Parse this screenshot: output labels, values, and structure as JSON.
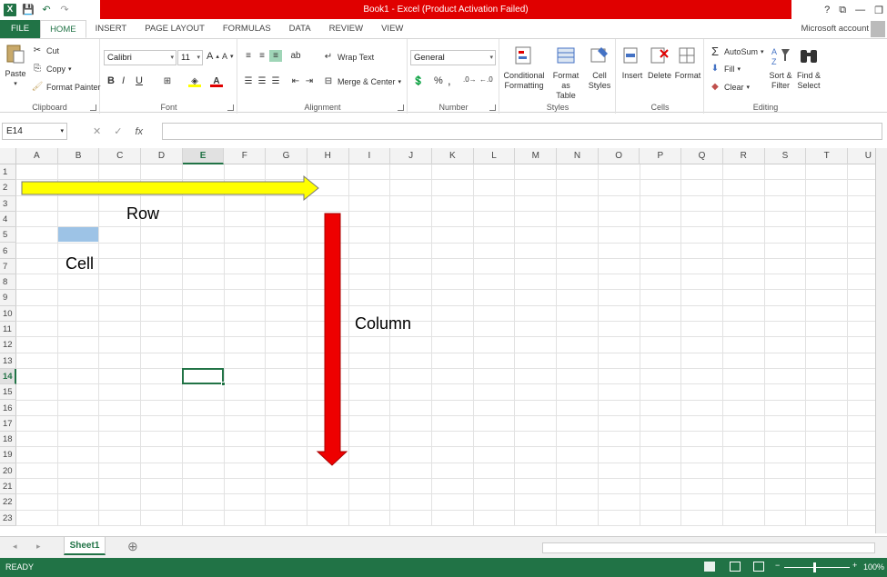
{
  "window": {
    "title": "Book1 -  Excel (Product Activation Failed)",
    "account": "Microsoft account",
    "controls": [
      "?",
      "⧉",
      "—",
      "❐"
    ]
  },
  "qat": {
    "save": "💾",
    "undo": "↶",
    "redo": "↷"
  },
  "tabs": {
    "file": "FILE",
    "items": [
      "HOME",
      "INSERT",
      "PAGE LAYOUT",
      "FORMULAS",
      "DATA",
      "REVIEW",
      "VIEW"
    ],
    "active": "HOME"
  },
  "ribbon": {
    "clipboard": {
      "label": "Clipboard",
      "paste": "Paste",
      "cut": "Cut",
      "copy": "Copy",
      "painter": "Format Painter"
    },
    "font": {
      "label": "Font",
      "name": "Calibri",
      "size": "11",
      "bold": "B",
      "italic": "I",
      "underline": "U",
      "grow": "A",
      "shrink": "A"
    },
    "alignment": {
      "label": "Alignment",
      "wrap": "Wrap Text",
      "merge": "Merge & Center"
    },
    "number": {
      "label": "Number",
      "format": "General",
      "percent": "%",
      "comma": ","
    },
    "styles": {
      "label": "Styles",
      "conditional": [
        "Conditional",
        "Formatting"
      ],
      "table": [
        "Format as",
        "Table"
      ],
      "cell": [
        "Cell",
        "Styles"
      ]
    },
    "cells": {
      "label": "Cells",
      "insert": "Insert",
      "delete": "Delete",
      "format": "Format"
    },
    "editing": {
      "label": "Editing",
      "autosum": "AutoSum",
      "fill": "Fill",
      "clear": "Clear",
      "sort": [
        "Sort &",
        "Filter"
      ],
      "find": [
        "Find &",
        "Select"
      ]
    }
  },
  "formula_bar": {
    "name_box": "E14",
    "fx": "fx",
    "cancel": "✕",
    "enter": "✓",
    "value": ""
  },
  "grid": {
    "columns": [
      "A",
      "B",
      "C",
      "D",
      "E",
      "F",
      "G",
      "H",
      "I",
      "J",
      "K",
      "L",
      "M",
      "N",
      "O",
      "P",
      "Q",
      "R",
      "S",
      "T",
      "U"
    ],
    "rows": [
      "1",
      "2",
      "3",
      "4",
      "5",
      "6",
      "7",
      "8",
      "9",
      "10",
      "11",
      "12",
      "13",
      "14",
      "15",
      "16",
      "17",
      "18",
      "19",
      "20",
      "21",
      "22",
      "23"
    ],
    "selected_cell": "E14",
    "highlighted_cell": "B5"
  },
  "annotations": {
    "row": "Row",
    "cell": "Cell",
    "column": "Column"
  },
  "colors": {
    "accent": "#217346",
    "title_bar": "#e00000",
    "row_arrow": "#ffff00",
    "column_arrow": "#ee0000",
    "cell_highlight": "#9dc3e6"
  },
  "sheets": {
    "tabs": [
      "Sheet1"
    ],
    "add": "⊕"
  },
  "status": {
    "text": "READY",
    "zoom": "100%",
    "zoom_minus": "−",
    "zoom_plus": "+"
  }
}
